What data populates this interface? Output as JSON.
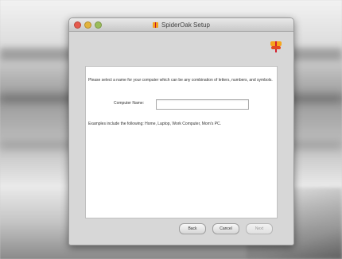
{
  "window": {
    "title": "SpiderOak Setup"
  },
  "content": {
    "instructions": "Please select a name for your computer which can be any combination of letters, numbers, and symbols.",
    "computer_name_label": "Computer Name:",
    "computer_name_value": "",
    "example_text": "Examples include the following: Home, Laptop, Work Computer, Mom's PC."
  },
  "buttons": {
    "back": "Back",
    "cancel": "Cancel",
    "next": "Next"
  }
}
